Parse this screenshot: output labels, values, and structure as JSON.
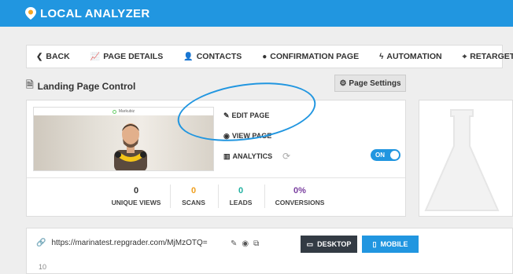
{
  "app": {
    "title": "LOCAL ANALYZER"
  },
  "nav": {
    "items": [
      {
        "label": "BACK",
        "icon": "chevron-left-icon"
      },
      {
        "label": "PAGE DETAILS",
        "icon": "line-chart-icon"
      },
      {
        "label": "CONTACTS",
        "icon": "user-icon"
      },
      {
        "label": "CONFIRMATION PAGE",
        "icon": "circle-icon"
      },
      {
        "label": "AUTOMATION",
        "icon": "bolt-icon"
      },
      {
        "label": "RETARGETING",
        "icon": "crosshair-icon"
      }
    ]
  },
  "section": {
    "title": "Landing Page Control",
    "icon": "file-icon"
  },
  "settings_button": {
    "label": "Page Settings",
    "icon": "gear-icon"
  },
  "preview": {
    "brand": "Markubiz"
  },
  "actions": {
    "edit": "EDIT PAGE",
    "view": "VIEW PAGE",
    "analytics": "ANALYTICS"
  },
  "toggle": {
    "label": "ON",
    "state": "on"
  },
  "stats": [
    {
      "value": "0",
      "label": "UNIQUE VIEWS",
      "color": "#333333"
    },
    {
      "value": "0",
      "label": "SCANS",
      "color": "#f0a020"
    },
    {
      "value": "0",
      "label": "LEADS",
      "color": "#20b0a0"
    },
    {
      "value": "0%",
      "label": "CONVERSIONS",
      "color": "#7a3fa0"
    }
  ],
  "url": {
    "text": "https://marinatest.repgrader.com/MjMzOTQ="
  },
  "device_buttons": {
    "desktop": "DESKTOP",
    "mobile": "MOBILE"
  },
  "chart": {
    "axis_top": "10"
  },
  "colors": {
    "primary": "#2196e0",
    "dark": "#333b44"
  }
}
